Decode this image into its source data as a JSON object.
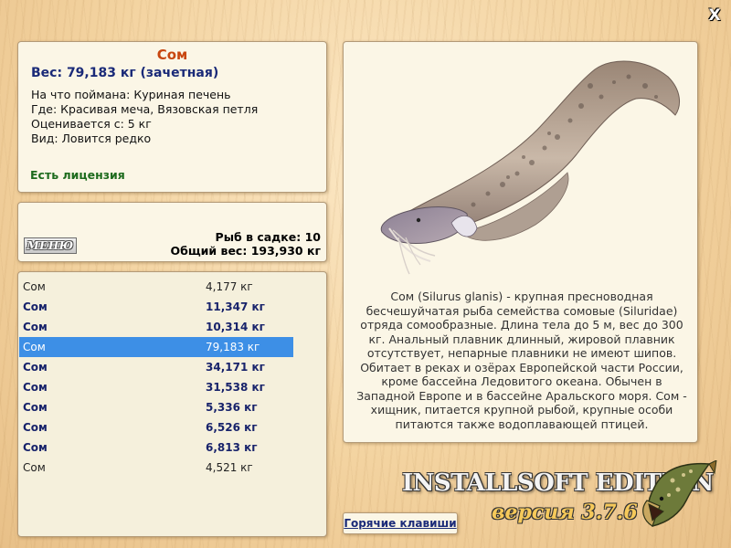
{
  "window": {
    "close_glyph": "X"
  },
  "fish": {
    "name": "Сом",
    "weight_line": "Вес: 79,183 кг (зачетная)",
    "bait": "На что поймана: Куриная печень",
    "location": "Где: Красивая меча, Вязовская петля",
    "rated_from": "Оценивается с: 5 кг",
    "kind": "Вид: Ловится редко",
    "license": "Есть лицензия"
  },
  "keep": {
    "menu_label": "МЕНЮ",
    "count_text": "Рыб в садке: 10",
    "total_text": "Общий вес: 193,930 кг"
  },
  "catch_list": [
    {
      "name": "Сом",
      "weight": "4,177 кг",
      "style": "normal"
    },
    {
      "name": "Сом",
      "weight": "11,347 кг",
      "style": "bold"
    },
    {
      "name": "Сом",
      "weight": "10,314 кг",
      "style": "bold"
    },
    {
      "name": "Сом",
      "weight": "79,183 кг",
      "style": "selected"
    },
    {
      "name": "Сом",
      "weight": "34,171 кг",
      "style": "bold"
    },
    {
      "name": "Сом",
      "weight": "31,538 кг",
      "style": "bold"
    },
    {
      "name": "Сом",
      "weight": "5,336 кг",
      "style": "bold"
    },
    {
      "name": "Сом",
      "weight": "6,526 кг",
      "style": "bold"
    },
    {
      "name": "Сом",
      "weight": "6,813 кг",
      "style": "bold"
    },
    {
      "name": "Сом",
      "weight": "4,521 кг",
      "style": "normal"
    }
  ],
  "description": "Сом (Silurus glanis) - крупная пресноводная бесчешуйчатая рыба семейства сомовые (Siluridae) отряда сомообразные. Длина тела до 5 м, вес до 300 кг. Анальный плавник длинный, жировой плавник отсутствует, непарные плавники не имеют шипов. Обитает в реках и озёрах Европейской части России, кроме бассейна Ледовитого океана. Обычен в Западной Европе и в бассейне Аральского моря. Сом - хищник, питается крупной рыбой, крупные особи питаются также водоплавающей птицей.",
  "footer": {
    "hotkeys_label": "Горячие клавиши",
    "brand": "INSTALLSOFT EDITION",
    "version": "версия 3.7.6"
  },
  "colors": {
    "title": "#c8460e",
    "weight": "#1a2a78",
    "license": "#1d6b1d",
    "selection": "#3d8fe6"
  },
  "icons": [
    "close-icon",
    "catfish-illustration",
    "pike-logo-icon"
  ]
}
